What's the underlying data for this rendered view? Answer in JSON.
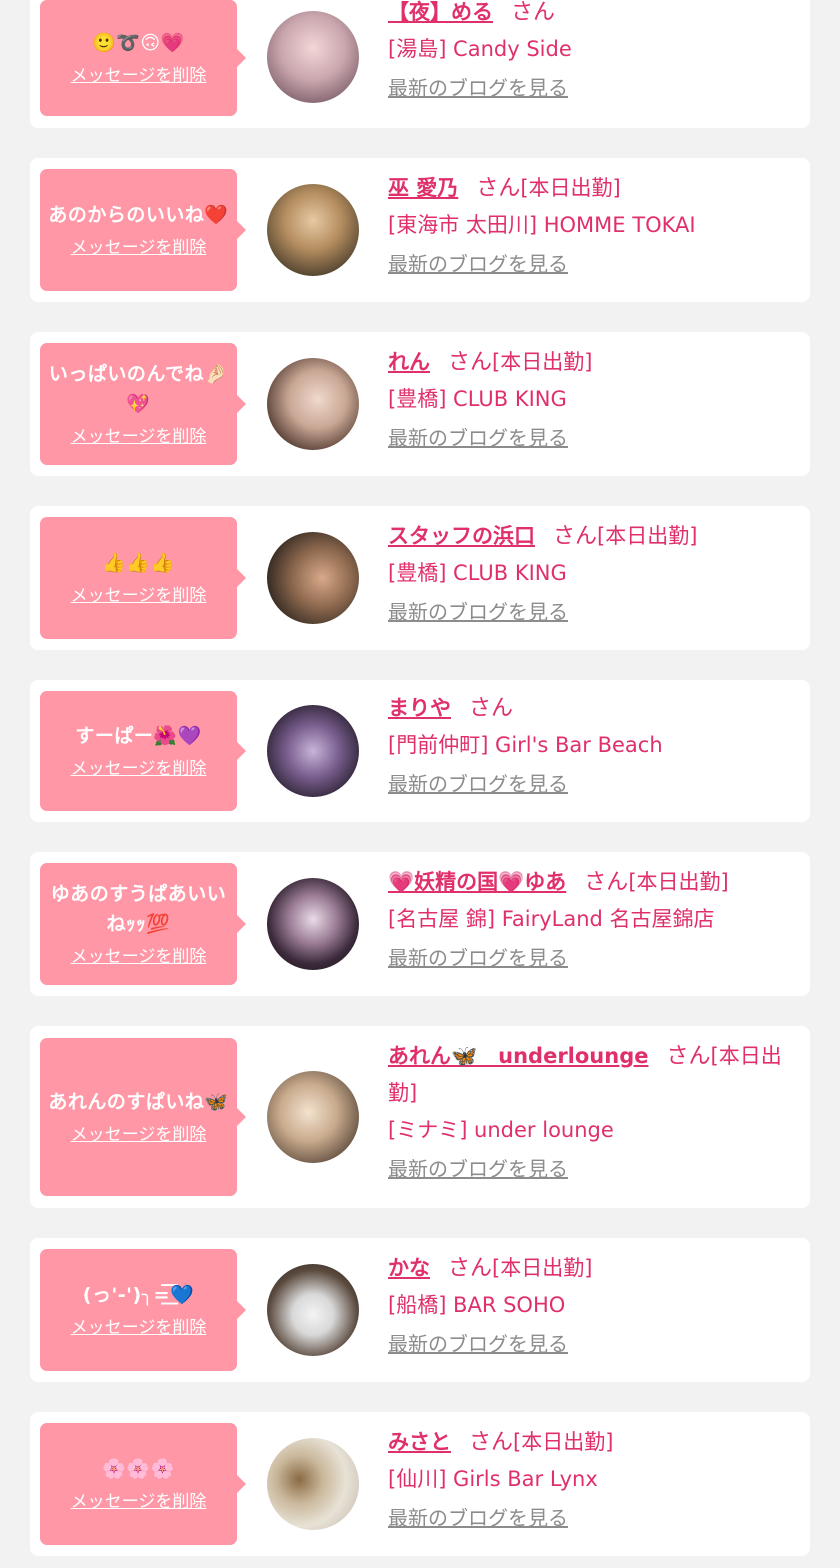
{
  "delete_label": "メッセージを削除",
  "blog_label": "最新のブログを見る",
  "san_label": "さん",
  "items": [
    {
      "message": "🙂➰🙃💗",
      "name": "【夜】める",
      "status": "",
      "shop": "[湯島] Candy Side"
    },
    {
      "message": "あのからのいいね❤️",
      "name": "巫 愛乃",
      "status": "[本日出勤]",
      "shop": "[東海市 太田川] HOMME TOKAI"
    },
    {
      "message": "いっぱいのんでね🤌🏻💖",
      "name": "れん",
      "status": "[本日出勤]",
      "shop": "[豊橋] CLUB KING"
    },
    {
      "message": "👍👍👍",
      "name": "スタッフの浜口",
      "status": "[本日出勤]",
      "shop": "[豊橋] CLUB KING"
    },
    {
      "message": "すーぱー🌺💜",
      "name": "まりや",
      "status": "",
      "shop": "[門前仲町] Girl's Bar Beach"
    },
    {
      "message": "ゆあのすうぱあいいねｯｯ💯",
      "name": "💗妖精の国💗ゆあ",
      "status": "[本日出勤]",
      "shop": "[名古屋 錦] FairyLand 名古屋錦店"
    },
    {
      "message": "あれんのすぱいね🦋",
      "name": "あれん🦋　underlounge",
      "status": "[本日出勤]",
      "shop": "[ミナミ] under lounge"
    },
    {
      "message": "(っ'-')╮=͟͟͞͞💙",
      "name": "かな",
      "status": "[本日出勤]",
      "shop": "[船橋] BAR SOHO"
    },
    {
      "message": "🌸🌸🌸",
      "name": "みさと",
      "status": "[本日出勤]",
      "shop": "[仙川] Girls Bar Lynx"
    }
  ],
  "colors": {
    "accent": "#e0306a",
    "bubble": "#ff97a6",
    "muted": "#8c8c8c",
    "background": "#f2f2f2"
  }
}
